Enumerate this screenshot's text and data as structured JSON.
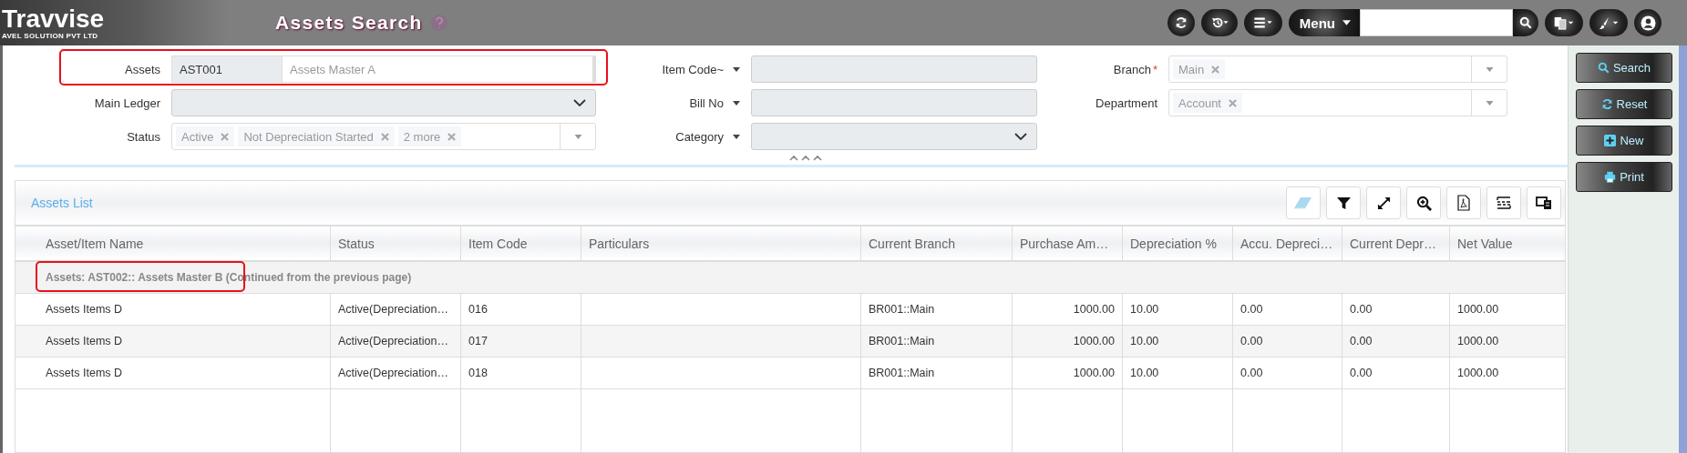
{
  "header": {
    "logo": {
      "name": "Travvise",
      "tagline": "AVEL SOLUTION PVT LTD"
    },
    "title": "Assets Search",
    "menu_label": "Menu"
  },
  "form": {
    "fields": [
      {
        "label": "Assets",
        "kind": "code_name",
        "code": "AST001",
        "value": "Assets Master A",
        "highlighted": true
      },
      {
        "label": "Item Code~",
        "kind": "text",
        "label_menu": true
      },
      {
        "label": "Branch",
        "required_mark": "*",
        "kind": "tags",
        "tags": [
          "Main"
        ]
      },
      {
        "label": "Main Ledger",
        "kind": "select"
      },
      {
        "label": "Bill No",
        "kind": "text",
        "label_menu": true
      },
      {
        "label": "Department",
        "kind": "tags",
        "tags": [
          "Account"
        ]
      },
      {
        "label": "Status",
        "kind": "tags",
        "tags": [
          "Active",
          "Not Depreciation Started",
          "2 more"
        ]
      },
      {
        "label": "Category",
        "kind": "select",
        "label_menu": true
      }
    ]
  },
  "actions": [
    "Search",
    "Reset",
    "New",
    "Print"
  ],
  "table": {
    "title": "Assets List",
    "columns": [
      {
        "label": "Asset/Item Name",
        "kind": "text"
      },
      {
        "label": "Status",
        "kind": "text"
      },
      {
        "label": "Item Code",
        "kind": "text"
      },
      {
        "label": "Particulars",
        "kind": "text"
      },
      {
        "label": "Current Branch",
        "kind": "text"
      },
      {
        "label": "Purchase Am…",
        "kind": "amount"
      },
      {
        "label": "Depreciation %",
        "kind": "text"
      },
      {
        "label": "Accu. Depreci…",
        "kind": "text"
      },
      {
        "label": "Current Depr…",
        "kind": "text"
      },
      {
        "label": "Net Value",
        "kind": "text"
      }
    ],
    "group": {
      "label": "Assets: AST002:: Assets Master B (Continued from the previous page)",
      "highlighted": true
    },
    "rows": [
      [
        "Assets Items D",
        "Active(Depreciation…",
        "016",
        "",
        "BR001::Main",
        "1000.00",
        "10.00",
        "0.00",
        "0.00",
        "1000.00"
      ],
      [
        "Assets Items D",
        "Active(Depreciation…",
        "017",
        "",
        "BR001::Main",
        "1000.00",
        "10.00",
        "0.00",
        "0.00",
        "1000.00"
      ],
      [
        "Assets Items D",
        "Active(Depreciation…",
        "018",
        "",
        "BR001::Main",
        "1000.00",
        "10.00",
        "0.00",
        "0.00",
        "1000.00"
      ]
    ]
  }
}
